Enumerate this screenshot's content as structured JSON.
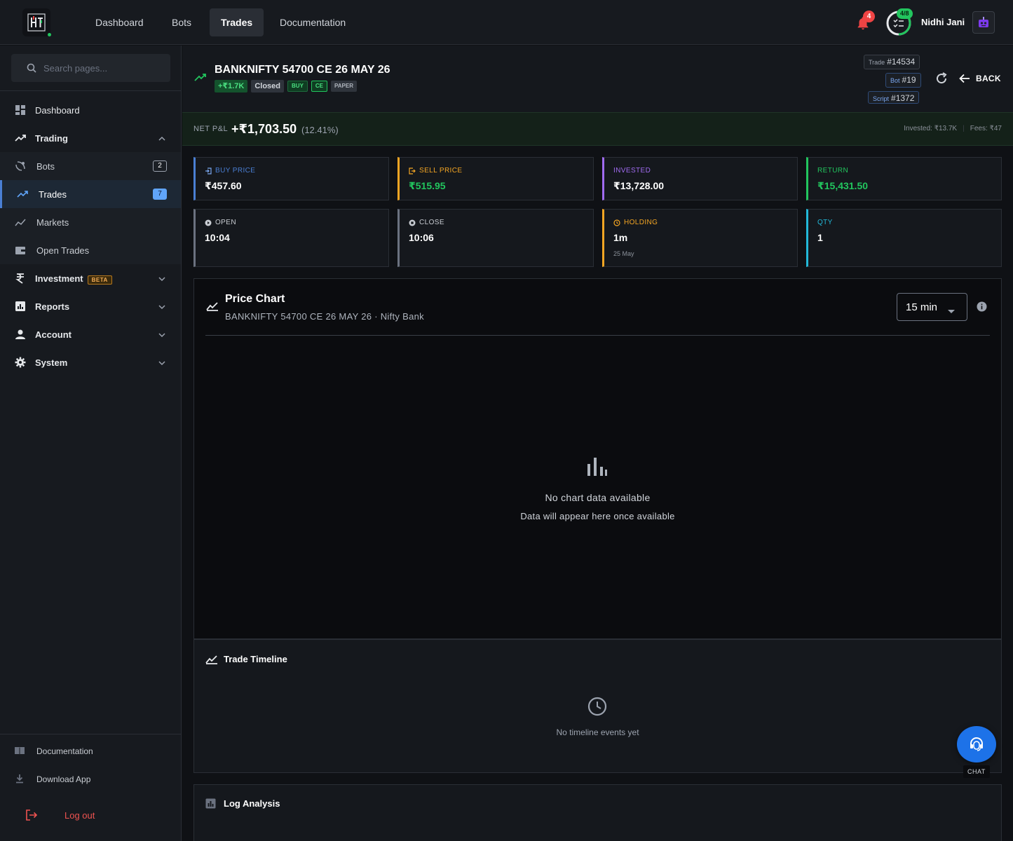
{
  "topbar": {
    "tabs": [
      {
        "label": "Dashboard",
        "active": false
      },
      {
        "label": "Bots",
        "active": false
      },
      {
        "label": "Trades",
        "active": true
      },
      {
        "label": "Documentation",
        "active": false
      }
    ],
    "notification_count": "4",
    "progress_text": "4/8",
    "progress_value": 0.5,
    "user_name": "Nidhi Jani",
    "icons": {
      "logo": "app-logo",
      "bell": "bell-icon",
      "tasks": "checklist-icon",
      "avatar": "robot-avatar"
    }
  },
  "sidebar": {
    "search_placeholder": "Search pages...",
    "items": [
      {
        "label": "Dashboard",
        "icon": "dashboard-icon"
      },
      {
        "label": "Trading",
        "icon": "trending-up-icon",
        "expanded": true
      },
      {
        "label": "Bots",
        "icon": "satellite-icon",
        "badge": "2"
      },
      {
        "label": "Trades",
        "icon": "trending-up-icon",
        "badge": "7",
        "selected": true
      },
      {
        "label": "Markets",
        "icon": "chart-line-icon"
      },
      {
        "label": "Open Trades",
        "icon": "wallet-icon"
      },
      {
        "label": "Investment",
        "icon": "rupee-icon",
        "tag": "BETA"
      },
      {
        "label": "Reports",
        "icon": "bar-chart-icon"
      },
      {
        "label": "Account",
        "icon": "person-icon"
      },
      {
        "label": "System",
        "icon": "gear-icon"
      }
    ],
    "bottom": [
      {
        "label": "Documentation",
        "icon": "book-icon"
      },
      {
        "label": "Download App",
        "icon": "download-icon"
      },
      {
        "label": "Log out",
        "icon": "logout-icon"
      }
    ]
  },
  "trade": {
    "title": "BANKNIFTY 54700 CE 26 MAY 26",
    "chips": {
      "pnl": "+₹1.7K",
      "status": "Closed",
      "side": "BUY",
      "option": "CE",
      "mode": "PAPER"
    },
    "refs": {
      "trade_label": "Trade",
      "trade_id": "#14534",
      "bot_label": "Bot",
      "bot_id": "#19",
      "script_label": "Script",
      "script_id": "#1372"
    },
    "back_label": "BACK"
  },
  "net": {
    "label": "NET P&L",
    "value": "+₹1,703.50",
    "pct": "(12.41%)",
    "invested": "Invested: ₹13.7K",
    "fees": "Fees: ₹47"
  },
  "stats": [
    {
      "label": "BUY PRICE",
      "value": "₹457.60",
      "icon": "login-icon",
      "color": "#4a7fd4"
    },
    {
      "label": "SELL PRICE",
      "value": "₹515.95",
      "icon": "logout-icon",
      "color": "#f5a623",
      "value_color": "#22c55e"
    },
    {
      "label": "INVESTED",
      "value": "₹13,728.00",
      "icon": "",
      "color": "#a06bf0"
    },
    {
      "label": "RETURN",
      "value": "₹15,431.50",
      "icon": "",
      "color": "#22c55e",
      "value_color": "#22c55e"
    },
    {
      "label": "OPEN",
      "value": "10:04",
      "icon": "play-circle-icon",
      "color": "#6b7280"
    },
    {
      "label": "CLOSE",
      "value": "10:06",
      "icon": "stop-circle-icon",
      "color": "#6b7280"
    },
    {
      "label": "HOLDING",
      "value": "1m",
      "sub": "25 May",
      "icon": "clock-icon",
      "color": "#f5a623"
    },
    {
      "label": "QTY",
      "value": "1",
      "icon": "",
      "color": "#22b8d8"
    }
  ],
  "chart": {
    "title": "Price Chart",
    "subtitle": "BANKNIFTY 54700 CE 26 MAY 26 · Nifty Bank",
    "interval": "15 min",
    "empty_title": "No chart data available",
    "empty_sub": "Data will appear here once available"
  },
  "timeline": {
    "title": "Trade Timeline",
    "empty": "No timeline events yet"
  },
  "log": {
    "title": "Log Analysis"
  },
  "chat": {
    "label": "CHAT"
  }
}
